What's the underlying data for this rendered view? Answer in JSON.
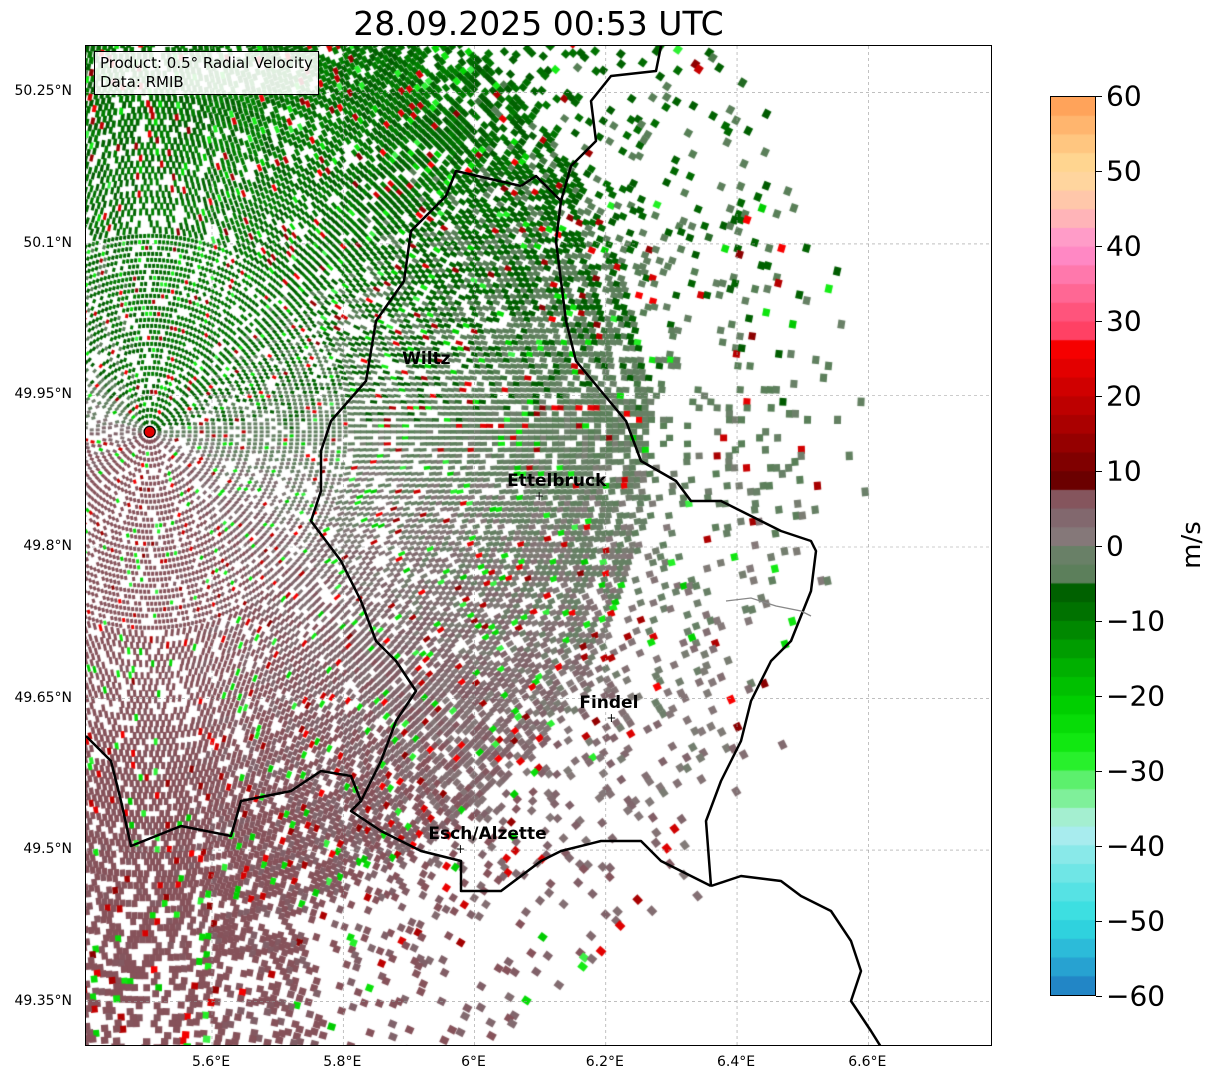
{
  "title": "28.09.2025 00:53 UTC",
  "info": {
    "product": "Product: 0.5° Radial Velocity",
    "data": "Data: RMIB"
  },
  "map": {
    "lon_range": [
      5.408,
      6.79
    ],
    "lat_range": [
      49.305,
      50.296
    ],
    "radar_site": {
      "lon": 5.505,
      "lat": 49.914
    },
    "x_ticks": [
      "5.6°E",
      "5.8°E",
      "6°E",
      "6.2°E",
      "6.4°E",
      "6.6°E"
    ],
    "x_tick_values": [
      5.6,
      5.8,
      6.0,
      6.2,
      6.4,
      6.6
    ],
    "y_ticks": [
      "50.25°N",
      "50.1°N",
      "49.95°N",
      "49.8°N",
      "49.65°N",
      "49.5°N",
      "49.35°N"
    ],
    "y_tick_values": [
      50.25,
      50.1,
      49.95,
      49.8,
      49.65,
      49.5,
      49.35
    ],
    "cities": [
      {
        "name": "Wiltz",
        "lon": 5.94,
        "lat": 49.97,
        "marker": false
      },
      {
        "name": "Ettelbruck",
        "lon": 6.1,
        "lat": 49.85,
        "marker": true
      },
      {
        "name": "Findel",
        "lon": 6.21,
        "lat": 49.63,
        "marker": true
      },
      {
        "name": "Esch/Alzette",
        "lon": 5.98,
        "lat": 49.5,
        "marker": true
      }
    ]
  },
  "colorbar": {
    "label": "m/s",
    "min": -60,
    "max": 60,
    "ticks": [
      "60",
      "50",
      "40",
      "30",
      "20",
      "10",
      "0",
      "−10",
      "−20",
      "−30",
      "−40",
      "−50",
      "−60"
    ],
    "stops": [
      [
        -60,
        "#1f78c0"
      ],
      [
        -55,
        "#2ab0d6"
      ],
      [
        -50,
        "#30dde0"
      ],
      [
        -42,
        "#80e8e8"
      ],
      [
        -37.5,
        "#b8eef0"
      ],
      [
        -35,
        "#90f0b0"
      ],
      [
        -31,
        "#58f068"
      ],
      [
        -28,
        "#18f018"
      ],
      [
        -22,
        "#00d400"
      ],
      [
        -15,
        "#00a800"
      ],
      [
        -8,
        "#006c00"
      ],
      [
        -5.1,
        "#005a00"
      ],
      [
        -5,
        "#567f55"
      ],
      [
        -1,
        "#6a8068"
      ],
      [
        1,
        "#857a7a"
      ],
      [
        5,
        "#806068"
      ],
      [
        7.4,
        "#8a4a52"
      ],
      [
        7.5,
        "#600000"
      ],
      [
        15,
        "#a00000"
      ],
      [
        27.4,
        "#ff0000"
      ],
      [
        27.5,
        "#ff3858"
      ],
      [
        35,
        "#ff70a0"
      ],
      [
        40,
        "#ff90d0"
      ],
      [
        45,
        "#ffc0b0"
      ],
      [
        50,
        "#ffdc98"
      ],
      [
        55,
        "#ffbe78"
      ],
      [
        60,
        "#ff9a50"
      ]
    ]
  }
}
